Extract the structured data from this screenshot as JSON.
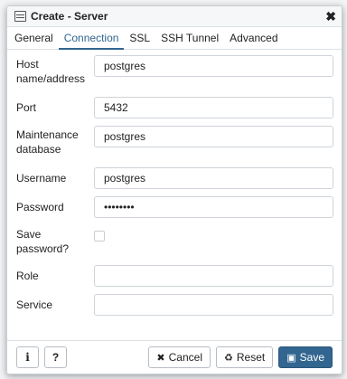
{
  "dialog": {
    "title": "Create - Server",
    "close_icon": "close-icon",
    "tabs": [
      {
        "label": "General",
        "active": false
      },
      {
        "label": "Connection",
        "active": true
      },
      {
        "label": "SSL",
        "active": false
      },
      {
        "label": "SSH Tunnel",
        "active": false
      },
      {
        "label": "Advanced",
        "active": false
      }
    ]
  },
  "form": {
    "host": {
      "label": "Host name/address",
      "value": "postgres"
    },
    "port": {
      "label": "Port",
      "value": "5432"
    },
    "maintenance_db": {
      "label": "Maintenance database",
      "value": "postgres"
    },
    "username": {
      "label": "Username",
      "value": "postgres"
    },
    "password": {
      "label": "Password",
      "value": "••••••••"
    },
    "save_password": {
      "label": "Save password?",
      "checked": false
    },
    "role": {
      "label": "Role",
      "value": ""
    },
    "service": {
      "label": "Service",
      "value": ""
    }
  },
  "footer": {
    "info_label": "i",
    "help_label": "?",
    "cancel_label": "Cancel",
    "reset_label": "Reset",
    "save_label": "Save"
  },
  "colors": {
    "accent": "#326690"
  }
}
